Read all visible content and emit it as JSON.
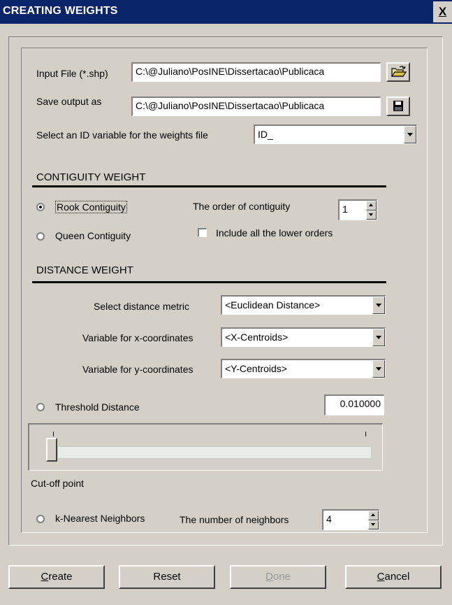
{
  "window": {
    "title": "CREATING WEIGHTS",
    "close_label": "X"
  },
  "input_file": {
    "label": "Input File (*.shp)",
    "value": "C:\\@Juliano\\PosINE\\Dissertacao\\Publicaca"
  },
  "save_output": {
    "label": "Save output as",
    "value": "C:\\@Juliano\\PosINE\\Dissertacao\\Publicaca"
  },
  "id_variable": {
    "label": "Select an ID variable for the weights file",
    "value": "ID_"
  },
  "contiguity": {
    "section_title": "CONTIGUITY WEIGHT",
    "rook_label": "Rook Contiguity",
    "rook_selected": true,
    "queen_label": "Queen Contiguity",
    "queen_selected": false,
    "order_label": "The order of contiguity",
    "order_value": "1",
    "include_lower_label": "Include all the lower orders",
    "include_lower_checked": false
  },
  "distance": {
    "section_title": "DISTANCE WEIGHT",
    "metric_label": "Select distance metric",
    "metric_value": "<Euclidean Distance>",
    "x_label": "Variable for x-coordinates",
    "x_value": "<X-Centroids>",
    "y_label": "Variable for y-coordinates",
    "y_value": "<Y-Centroids>",
    "threshold_label": "Threshold Distance",
    "threshold_selected": false,
    "threshold_value": "0.010000",
    "cutoff_label": "Cut-off point",
    "cutoff_fraction": 0.0,
    "knn_label": "k-Nearest Neighbors",
    "knn_selected": false,
    "neighbors_label": "The number of neighbors",
    "neighbors_value": "4"
  },
  "buttons": {
    "create": "Create",
    "reset": "Reset",
    "done": "Done",
    "cancel": "Cancel"
  },
  "icons": {
    "open": "open-folder-icon",
    "save": "floppy-disk-icon"
  }
}
